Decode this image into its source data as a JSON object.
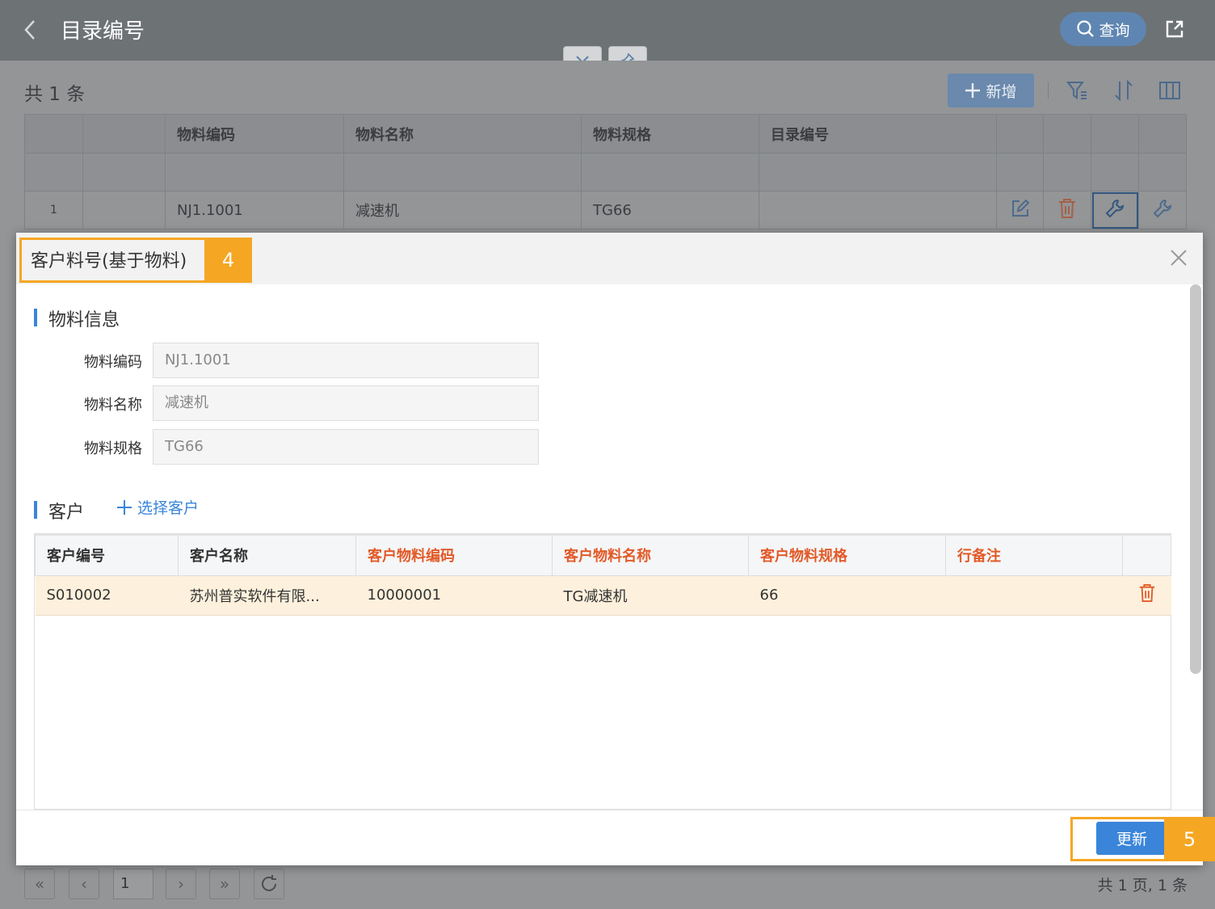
{
  "header": {
    "title": "目录编号",
    "query_label": "查询"
  },
  "list": {
    "count_text": "共 1 条",
    "add_label": "新增",
    "columns": [
      "物料编码",
      "物料名称",
      "物料规格",
      "目录编号"
    ],
    "rows": [
      {
        "index": "1",
        "code": "NJ1.1001",
        "name": "减速机",
        "spec": "TG66",
        "catalog": ""
      }
    ]
  },
  "pager": {
    "page": "1",
    "summary": "共 1 页, 1 条"
  },
  "modal": {
    "title": "客户料号(基于物料)",
    "callout_title": "4",
    "callout_update": "5",
    "section_material": "物料信息",
    "fields": [
      {
        "label": "物料编码",
        "value": "NJ1.1001"
      },
      {
        "label": "物料名称",
        "value": "减速机"
      },
      {
        "label": "物料规格",
        "value": "TG66"
      }
    ],
    "section_customer": "客户",
    "select_customer": "选择客户",
    "customer_columns": [
      "客户编号",
      "客户名称",
      "客户物料编码",
      "客户物料名称",
      "客户物料规格",
      "行备注"
    ],
    "customer_rows": [
      {
        "code": "S010002",
        "name": "苏州普实软件有限...",
        "mat_code": "10000001",
        "mat_name": "TG减速机",
        "mat_spec": "66",
        "remark": ""
      }
    ],
    "update_label": "更新"
  },
  "colors": {
    "accent": "#3a85d9",
    "required": "#e25a29",
    "callout": "#f5a623",
    "delete": "#e25a29"
  }
}
